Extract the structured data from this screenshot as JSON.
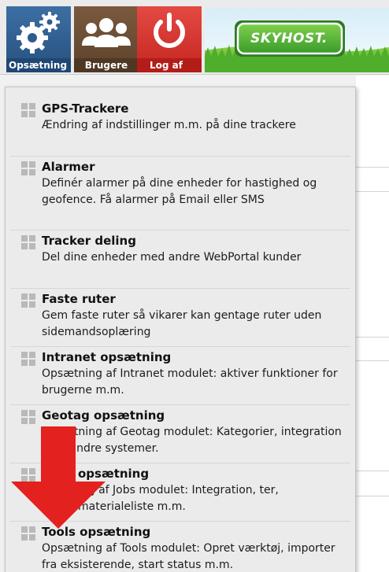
{
  "header": {
    "settings_label": "Opsætning",
    "users_label": "Brugere",
    "logout_label": "Log af",
    "brand": "SKYHOST."
  },
  "menu": {
    "items": [
      {
        "title": "GPS-Trackere",
        "description": "Ændring af indstillinger m.m. på dine trackere"
      },
      {
        "title": "Alarmer",
        "description": "Definér alarmer på dine enheder for hastighed og geofence. Få alarmer på Email eller SMS"
      },
      {
        "title": "Tracker deling",
        "description": "Del dine enheder med andre WebPortal kunder"
      },
      {
        "title": "Faste ruter",
        "description": "Gem faste ruter så vikarer kan gentage ruter uden sidemandsoplæring"
      },
      {
        "title": "Intranet opsætning",
        "description": "Opsætning af Intranet modulet: aktiver funktioner for brugerne m.m."
      },
      {
        "title": "Geotag opsætning",
        "description": "Opsætning af Geotag modulet: Kategorier, integration med andre systemer."
      },
      {
        "title": "opsætning",
        "description": "ing af Jobs modulet: Integration, ter, materialeliste m.m."
      },
      {
        "title": "Tools opsætning",
        "description": "Opsætning af Tools modulet: Opret værktøj, importer fra eksisterende, start status m.m."
      }
    ]
  },
  "overlay": {
    "arrow_color": "#e3211e"
  }
}
